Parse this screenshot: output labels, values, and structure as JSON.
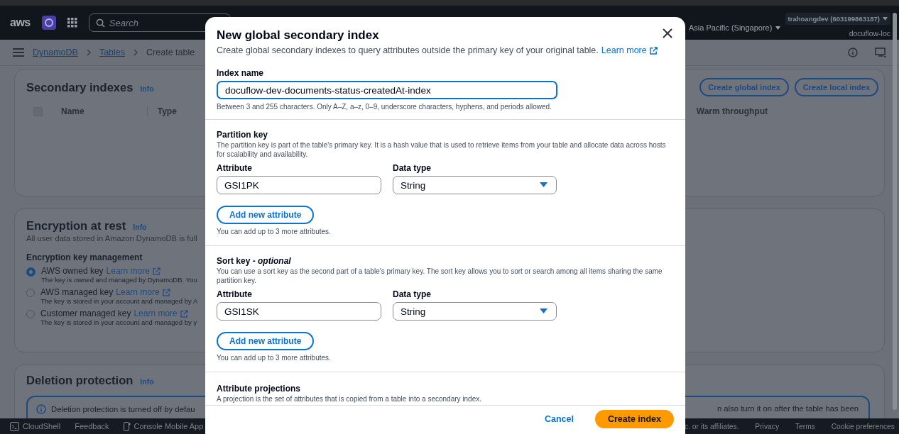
{
  "top_nav": {
    "logo": "aws",
    "search_placeholder": "Search",
    "region": "Asia Pacific (Singapore)",
    "account": "trahoangdev (603199863187)",
    "account_sub": "docuflow-loc"
  },
  "breadcrumbs": [
    {
      "label": "DynamoDB",
      "link": true
    },
    {
      "label": "Tables",
      "link": true
    },
    {
      "label": "Create table",
      "link": false
    }
  ],
  "secondary_indexes": {
    "title": "Secondary indexes",
    "info": "Info",
    "buttons": [
      "Create global index",
      "Create local index"
    ],
    "select_all_checked": false,
    "columns": [
      "Name",
      "Type",
      "Warm throughput"
    ]
  },
  "encryption": {
    "title": "Encryption at rest",
    "info": "Info",
    "description": "All user data stored in Amazon DynamoDB is full",
    "group_label": "Encryption key management",
    "options": [
      {
        "label": "AWS owned key",
        "link": "Learn more",
        "hint": "The key is owned and managed by DynamoDB. You",
        "selected": true
      },
      {
        "label": "AWS managed key",
        "link": "Learn more",
        "hint": "The key is stored in your account and managed by A",
        "selected": false
      },
      {
        "label": "Customer managed key",
        "link": "Learn more",
        "hint": "The key is stored in your account and managed by y",
        "selected": false
      }
    ]
  },
  "deletion_protection": {
    "title": "Deletion protection",
    "info": "Info",
    "alert_left": "Deletion protection is turned off by defau",
    "alert_right": "n also turn it on after the table has been"
  },
  "footer": {
    "left": [
      "CloudShell",
      "Feedback",
      "Console Mobile App"
    ],
    "copyright": "c. or its affiliates.",
    "links": [
      "Privacy",
      "Terms",
      "Cookie preferences"
    ]
  },
  "modal": {
    "title": "New global secondary index",
    "subtitle": "Create global secondary indexes to query attributes outside the primary key of your original table.",
    "subtitle_link": "Learn more",
    "index_name": {
      "label": "Index name",
      "value": "docuflow-dev-documents-status-createdAt-index",
      "hint": "Between 3 and 255 characters. Only A–Z, a–z, 0–9, underscore characters, hyphens, and periods allowed."
    },
    "keys": [
      {
        "title": "Partition key",
        "description": "The partition key is part of the table's primary key. It is a hash value that is used to retrieve items from your table and allocate data across hosts for scalability and availability.",
        "attribute_label": "Attribute",
        "attribute": "GSI1PK",
        "type_label": "Data type",
        "type": "String",
        "add_button": "Add new attribute",
        "add_hint": "You can add up to 3 more attributes."
      },
      {
        "title": "Sort key - ",
        "optional": "optional",
        "description": "You can use a sort key as the second part of a table's primary key. The sort key allows you to sort or search among all items sharing the same partition key.",
        "attribute_label": "Attribute",
        "attribute": "GSI1SK",
        "type_label": "Data type",
        "type": "String",
        "add_button": "Add new attribute",
        "add_hint": "You can add up to 3 more attributes."
      }
    ],
    "projections": {
      "title": "Attribute projections",
      "description": "A projection is the set of attributes that is copied from a table into a secondary index."
    },
    "buttons": [
      {
        "label": "Cancel",
        "kind": "link"
      },
      {
        "label": "Create index",
        "kind": "primary"
      }
    ]
  }
}
